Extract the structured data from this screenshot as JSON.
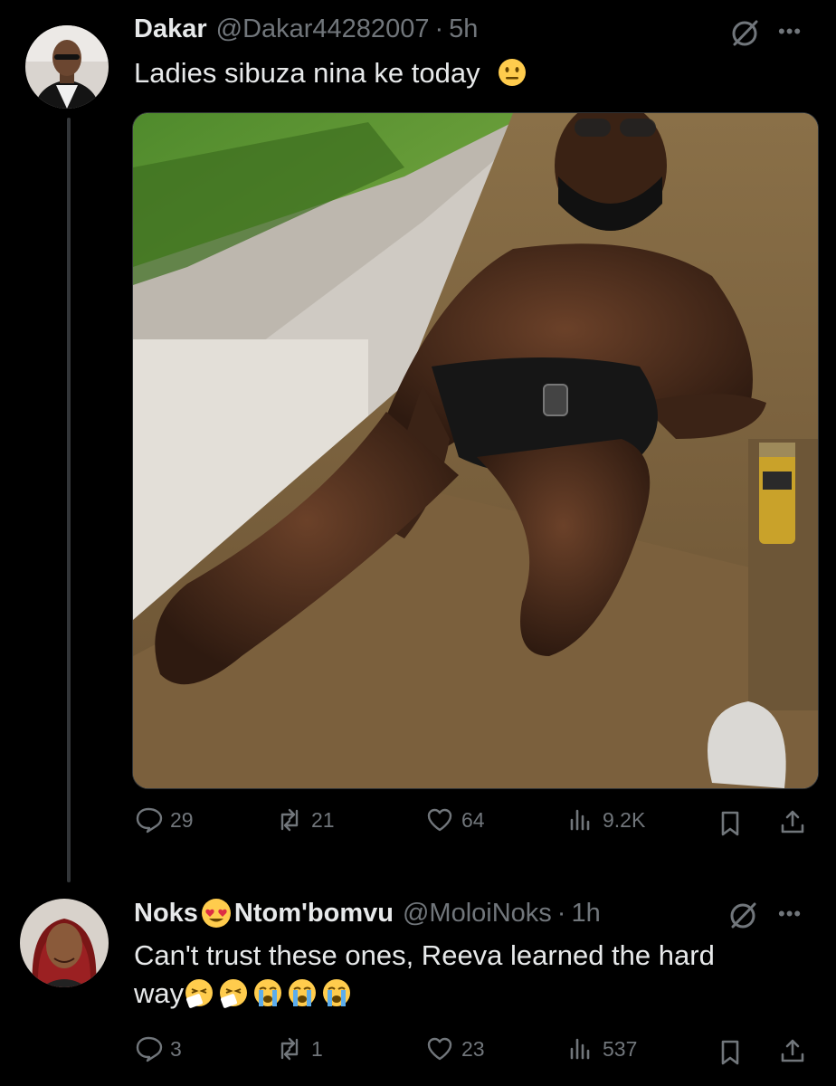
{
  "tweet1": {
    "name": "Dakar",
    "handle": "@Dakar44282007",
    "separator": "·",
    "time": "5h",
    "text": "Ladies sibuza nina ke today",
    "text_emoji": "neutral-face",
    "media": {
      "description_icon": "photo"
    },
    "stats": {
      "replies": "29",
      "reposts": "21",
      "likes": "64",
      "views": "9.2K"
    }
  },
  "tweet2": {
    "name_part1": "Noks",
    "name_emoji": "heart-eyes-face",
    "name_part2": "Ntom'bomvu",
    "handle": "@MoloiNoks",
    "separator": "·",
    "time": "1h",
    "text_line1": "Can't trust these ones, Reeva learned the hard",
    "text_line2": "way",
    "text_emojis": [
      "sneezing-face",
      "sneezing-face",
      "crying-face",
      "crying-face",
      "crying-face"
    ],
    "stats": {
      "replies": "3",
      "reposts": "1",
      "likes": "23",
      "views": "537"
    }
  },
  "colors": {
    "background": "#000000",
    "text": "#e7e9ea",
    "muted": "#71767b",
    "line": "#333639"
  }
}
